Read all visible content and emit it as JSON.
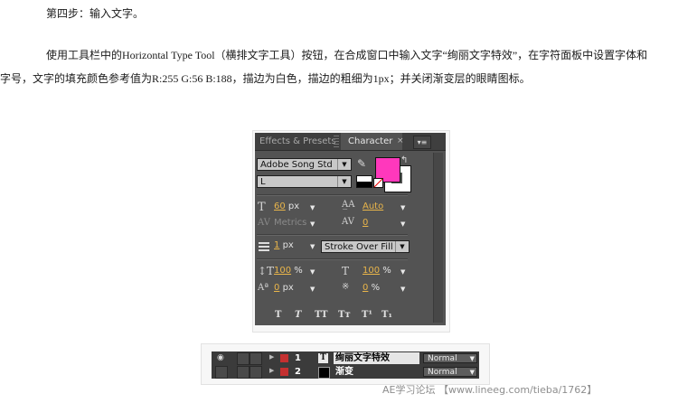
{
  "step": "第四步：输入文字。",
  "paragraph": {
    "line1": "使用工具栏中的Horizontal Type Tool（横排文字工具）按钮，在合成窗口中输入文字“绚丽文字特效”，在字符面板中设置字体和",
    "line2": "字号，文字的填充颜色参考值为R:255 G:56 B:188，描边为白色，描边的粗细为1px；并关闭渐变层的眼睛图标。"
  },
  "panel": {
    "tabs": [
      "Effects & Presets",
      "Character"
    ],
    "close_glyph": "×",
    "menu_glyph": "▾≡",
    "font_family": "Adobe Song Std",
    "font_style": "L",
    "fill_color": "#ff38bc",
    "stroke_color": "#ffffff",
    "font_size": {
      "value": "60",
      "unit": "px"
    },
    "leading": {
      "value": "Auto"
    },
    "kerning": {
      "value": "Metrics"
    },
    "tracking": {
      "value": "0"
    },
    "stroke_width": {
      "value": "1",
      "unit": "px"
    },
    "stroke_type": "Stroke Over Fill",
    "vertical_scale": {
      "value": "100",
      "unit": "%"
    },
    "horizontal_scale": {
      "value": "100",
      "unit": "%"
    },
    "baseline_shift": {
      "value": "0",
      "unit": "px"
    },
    "tsume": {
      "value": "0",
      "unit": "%"
    },
    "format_buttons": [
      "T",
      "T",
      "TT",
      "Tт",
      "T¹",
      "T₁"
    ]
  },
  "layers": [
    {
      "number": "1",
      "type": "T",
      "name": "绚丽文字特效",
      "mode": "Normal",
      "eye_visible": true
    },
    {
      "number": "2",
      "type": "solid",
      "name": "渐变",
      "mode": "Normal",
      "eye_visible": false
    }
  ],
  "watermark": "AE学习论坛 【www.lineeg.com/tieba/1762】",
  "icons": {
    "eye": "eye-icon",
    "dropper": "eyedropper-icon",
    "swap": "swap-colors-icon"
  }
}
